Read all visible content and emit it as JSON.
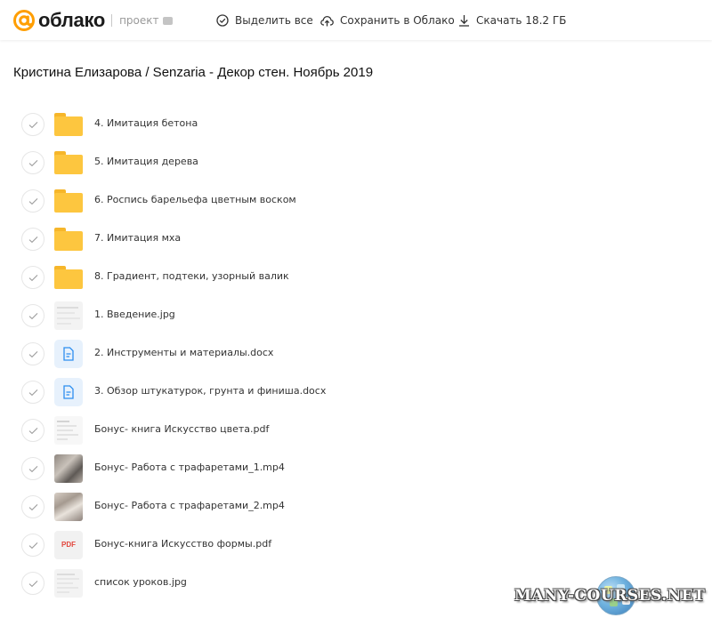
{
  "header": {
    "logo_text": "облако",
    "project_label": "проект",
    "select_all": "Выделить все",
    "save_to_cloud": "Сохранить в Облако",
    "download": "Скачать 18.2 ГБ"
  },
  "page_title": "Кристина Елизарова / Senzaria - Декор стен. Ноябрь 2019",
  "files": [
    {
      "name": "4. Имитация бетона",
      "kind": "folder"
    },
    {
      "name": "5. Имитация дерева",
      "kind": "folder"
    },
    {
      "name": "6. Роспись барельефа цветным воском",
      "kind": "folder"
    },
    {
      "name": "7. Имитация мха",
      "kind": "folder"
    },
    {
      "name": "8. Градиент, подтеки, узорный валик",
      "kind": "folder"
    },
    {
      "name": "1. Введение.jpg",
      "kind": "image"
    },
    {
      "name": "2. Инструменты и материалы.docx",
      "kind": "docx"
    },
    {
      "name": "3. Обзор штукатурок, грунта и финиша.docx",
      "kind": "docx"
    },
    {
      "name": "Бонус- книга Искусство цвета.pdf",
      "kind": "pdf-preview"
    },
    {
      "name": "Бонус- Работа с трафаретами_1.mp4",
      "kind": "video"
    },
    {
      "name": "Бонус- Работа с трафаретами_2.mp4",
      "kind": "video"
    },
    {
      "name": "Бонус-книга Искусство формы.pdf",
      "kind": "pdf"
    },
    {
      "name": "список уроков.jpg",
      "kind": "image"
    }
  ],
  "pdf_badge": "PDF",
  "watermark": "MANY-COURSES.NET",
  "colors": {
    "brand_orange": "#ff9e00",
    "folder": "#fdc63f",
    "doc_bg": "#e7f1fc",
    "doc_icon": "#2d8ef0",
    "pdf_red": "#e2463d"
  }
}
